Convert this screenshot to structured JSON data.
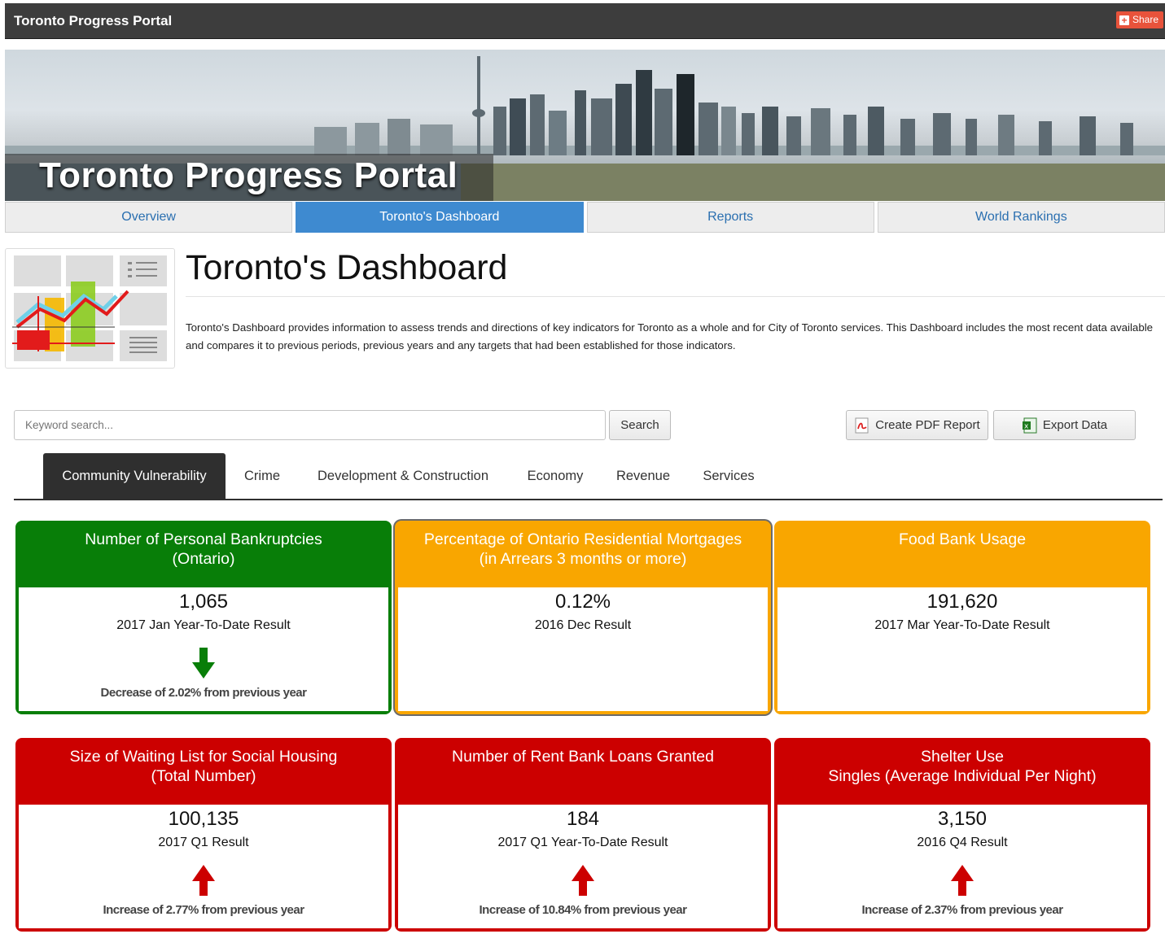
{
  "app": {
    "title": "Toronto Progress Portal",
    "share_label": "Share"
  },
  "banner": {
    "title": "Toronto Progress Portal"
  },
  "nav": {
    "items": [
      "Overview",
      "Toronto's Dashboard",
      "Reports",
      "World Rankings"
    ],
    "active": "Toronto's Dashboard"
  },
  "page": {
    "title": "Toronto's Dashboard",
    "description": "Toronto's Dashboard provides information to assess trends and directions of key indicators for Toronto as a whole and for City of Toronto services. This Dashboard includes the most recent data available and compares it to previous periods, previous years and any targets that had been established for those indicators."
  },
  "search": {
    "placeholder": "Keyword search...",
    "button": "Search"
  },
  "actions": {
    "pdf": "Create PDF Report",
    "export": "Export Data"
  },
  "tabs": {
    "items": [
      "Community Vulnerability",
      "Crime",
      "Development & Construction",
      "Economy",
      "Revenue",
      "Services"
    ],
    "active": "Community Vulnerability"
  },
  "cards": [
    {
      "title_1": "Number of Personal Bankruptcies",
      "title_2": "(Ontario)",
      "value": "1,065",
      "period": "2017 Jan Year-To-Date Result",
      "change": "Decrease of 2.02% from previous year",
      "status": "green",
      "trend": "down"
    },
    {
      "title_1": "Percentage of Ontario Residential Mortgages",
      "title_2": "(in Arrears 3 months or more)",
      "value": "0.12%",
      "period": "2016 Dec Result",
      "change": "",
      "status": "orange",
      "trend": "none"
    },
    {
      "title_1": "Food Bank Usage",
      "title_2": "",
      "value": "191,620",
      "period": "2017 Mar Year-To-Date Result",
      "change": "",
      "status": "orange",
      "trend": "none"
    },
    {
      "title_1": "Size of Waiting List for Social Housing",
      "title_2": "(Total Number)",
      "value": "100,135",
      "period": "2017 Q1 Result",
      "change": "Increase of 2.77% from previous year",
      "status": "red",
      "trend": "up"
    },
    {
      "title_1": "Number of Rent Bank Loans Granted",
      "title_2": "",
      "value": "184",
      "period": "2017 Q1 Year-To-Date Result",
      "change": "Increase of 10.84% from previous year",
      "status": "red",
      "trend": "up"
    },
    {
      "title_1": "Shelter Use",
      "title_2": "Singles (Average Individual Per Night)",
      "value": "3,150",
      "period": "2016 Q4 Result",
      "change": "Increase of 2.37% from previous year",
      "status": "red",
      "trend": "up"
    }
  ],
  "colors": {
    "green": "#087e08",
    "orange": "#f9a600",
    "red": "#cc0000",
    "nav_active": "#3e8ad0"
  }
}
